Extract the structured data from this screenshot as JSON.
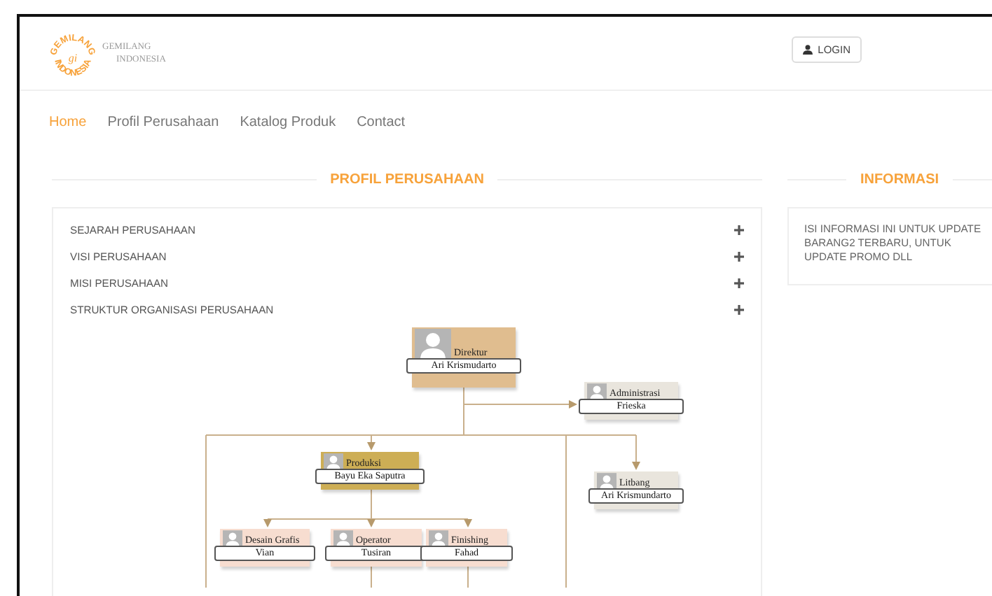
{
  "logo": {
    "ring_top": "GEMILANG",
    "ring_bottom": "INDONESIA",
    "monogram": "gi",
    "name_line_1": "GEMILANG",
    "name_line_2": "INDONESIA"
  },
  "login_button": {
    "label": "LOGIN"
  },
  "nav": [
    {
      "label": "Home",
      "selected": true
    },
    {
      "label": "Profil Perusahaan",
      "selected": false
    },
    {
      "label": "Katalog Produk",
      "selected": false
    },
    {
      "label": "Contact",
      "selected": false
    }
  ],
  "profile_section": {
    "title": "PROFIL PERUSAHAAN",
    "accordion": [
      {
        "label": "SEJARAH PERUSAHAAN",
        "expanded": false
      },
      {
        "label": "VISI PERUSAHAAN",
        "expanded": false
      },
      {
        "label": "MISI PERUSAHAAN",
        "expanded": false
      },
      {
        "label": "STRUKTUR ORGANISASI PERUSAHAAN",
        "expanded": false
      }
    ],
    "org_chart": {
      "title": "Direktur",
      "name": "Ari Krismudarto",
      "color": "#e0bd8f",
      "children": [
        {
          "title": "Administrasi",
          "name": "Frieska",
          "color": "#e9e5dd"
        },
        {
          "title": "Produksi",
          "name": "Bayu Eka Saputra",
          "color": "#cdae55",
          "children": [
            {
              "title": "Desain Grafis",
              "name": "Vian",
              "color": "#f7ddd0"
            },
            {
              "title": "Operator",
              "name": "Tusiran",
              "color": "#f7ddd0"
            },
            {
              "title": "Finishing",
              "name": "Fahad",
              "color": "#f7ddd0"
            }
          ]
        },
        {
          "title": "Litbang",
          "name": "Ari Krismundarto",
          "color": "#e9e5dd"
        }
      ]
    }
  },
  "info_section": {
    "title": "INFORMASI",
    "text": "ISI INFORMASI INI UNTUK UPDATE BARANG2 TERBARU, UNTUK UPDATE PROMO DLL"
  }
}
